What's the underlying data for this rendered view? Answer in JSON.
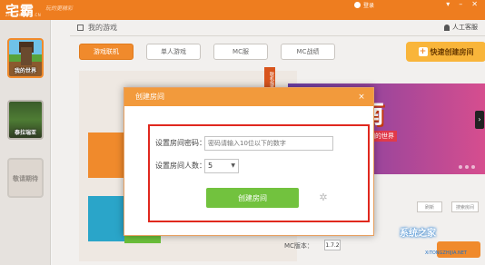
{
  "app": {
    "logo_text": "宅霸",
    "logo_sub": "ZHAIBA.COM.CN",
    "logo_script": "玩的更精彩",
    "login_label": "登录"
  },
  "sidebar": {
    "games": [
      {
        "label": "我的世界"
      },
      {
        "label": "泰拉瑞亚"
      },
      {
        "label": "敬请期待"
      }
    ]
  },
  "header": {
    "my_rooms": "我的游戏",
    "support": "人工客服"
  },
  "tabs": [
    {
      "label": "游戏联机",
      "active": true
    },
    {
      "label": "单人游戏",
      "active": false
    },
    {
      "label": "MC服",
      "active": false
    },
    {
      "label": "MC战绩",
      "active": false
    }
  ],
  "create_room_button": "快速创建房间",
  "side_banner": "联机指南",
  "promo": {
    "title": "指南",
    "subtitle": "来看看我们的世界"
  },
  "background": {
    "btn1": "刷新",
    "btn2": "搜索房间",
    "version_label": "MC版本：",
    "version_value": "1.7.2"
  },
  "modal": {
    "title": "创建房间",
    "close": "×",
    "password_label": "设置房间密码：",
    "password_placeholder": "密码请输入10位以下的数字",
    "count_label": "设置房间人数：",
    "count_value": "5",
    "create_button": "创建房间"
  },
  "watermark": {
    "text": "系统之家",
    "url": "XiTONGZHIJIA.NET"
  },
  "colors": {
    "accent": "#f08a2c",
    "modal_border": "#e0281e",
    "create_button": "#72c23e"
  }
}
